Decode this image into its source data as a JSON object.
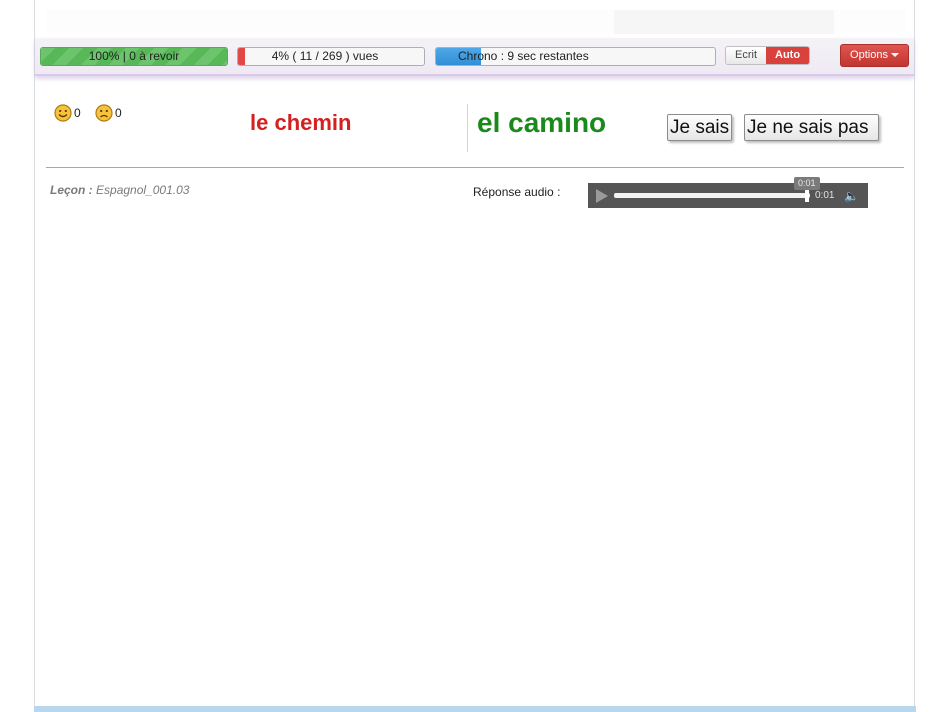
{
  "toolbar": {
    "review_bar": {
      "label": "100%  |  0 à revoir",
      "progress": 1.0,
      "color": "#6cc46c"
    },
    "seen_bar": {
      "label": "4% ( 11 / 269 ) vues",
      "progress": 0.04,
      "color": "#e04848"
    },
    "chrono_bar": {
      "label": "Chrono : 9 sec restantes",
      "progress": 0.16,
      "color": "#2f8fd6"
    },
    "mode_toggle": {
      "written_label": "Ecrit",
      "auto_label": "Auto",
      "selected": "Auto"
    },
    "options_label": "Options"
  },
  "scores": {
    "happy_count": "0",
    "sad_count": "0"
  },
  "card": {
    "prompt_word": "le chemin",
    "answer_word": "el camino",
    "know_label": "Je sais",
    "dont_know_label": "Je ne sais pas"
  },
  "lesson": {
    "label": "Leçon :",
    "name": "Espagnol_001.03"
  },
  "audio": {
    "label": "Réponse audio :",
    "current_time": "0:01",
    "tooltip_time": "0:01",
    "progress": 0.98
  },
  "colors": {
    "prompt": "#d42020",
    "answer": "#1a8a1a",
    "accent_red": "#d9413c"
  }
}
